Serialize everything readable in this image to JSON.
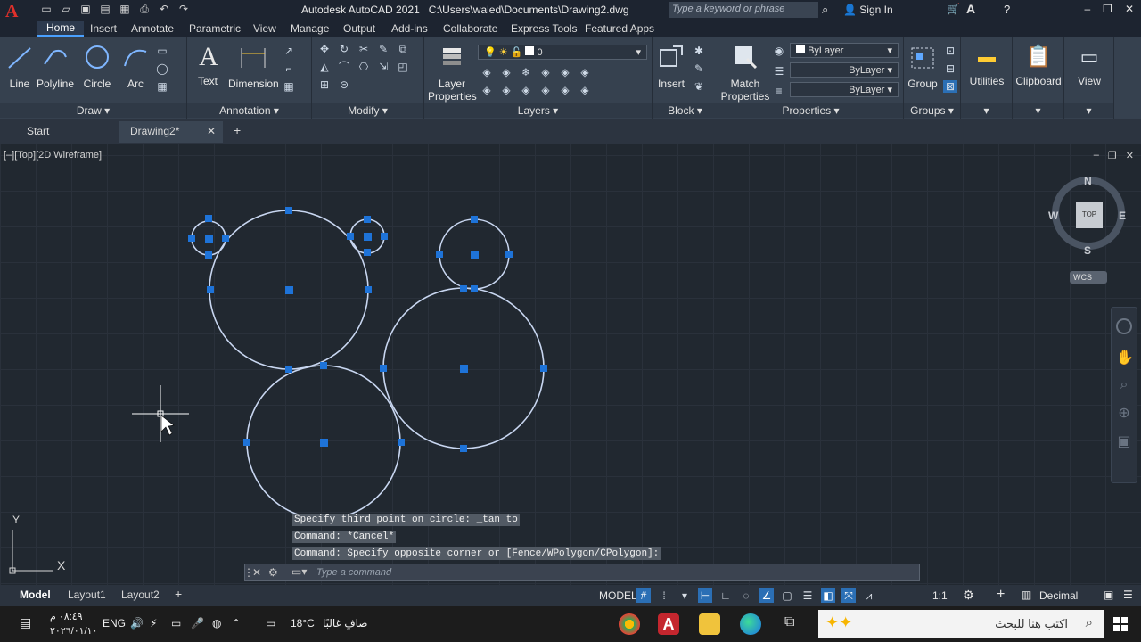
{
  "title": {
    "app": "Autodesk AutoCAD 2021",
    "path": "C:\\Users\\waled\\Documents\\Drawing2.dwg",
    "search_placeholder": "Type a keyword or phrase",
    "signin": "Sign In"
  },
  "ribbon_tabs": [
    "Home",
    "Insert",
    "Annotate",
    "Parametric",
    "View",
    "Manage",
    "Output",
    "Add-ins",
    "Collaborate",
    "Express Tools",
    "Featured Apps"
  ],
  "draw": {
    "line": "Line",
    "polyline": "Polyline",
    "circle": "Circle",
    "arc": "Arc",
    "title": "Draw"
  },
  "annotation": {
    "text": "Text",
    "dimension": "Dimension",
    "title": "Annotation"
  },
  "modify": {
    "title": "Modify"
  },
  "layers": {
    "layer_properties_1": "Layer",
    "layer_properties_2": "Properties",
    "layer_name": "0",
    "title": "Layers"
  },
  "block": {
    "insert": "Insert",
    "title": "Block"
  },
  "properties": {
    "match_1": "Match",
    "match_2": "Properties",
    "color": "ByLayer",
    "linetype": "ByLayer",
    "lineweight": "ByLayer",
    "title": "Properties"
  },
  "groups": {
    "group": "Group",
    "title": "Groups"
  },
  "utilities": {
    "label": "Utilities"
  },
  "clipboard": {
    "label": "Clipboard"
  },
  "view": {
    "label": "View"
  },
  "doc_tabs": {
    "start": "Start",
    "drawing": "Drawing2*",
    "close": "✕",
    "add": "+"
  },
  "viewport": {
    "label": "[–][Top][2D Wireframe]",
    "viewcube": {
      "n": "N",
      "s": "S",
      "e": "E",
      "w": "W",
      "top": "TOP",
      "wcs": "WCS"
    },
    "ucs": {
      "x": "X",
      "y": "Y"
    }
  },
  "command": {
    "history": [
      "Specify third point on circle: _tan to",
      "Command: *Cancel*",
      "Command: Specify opposite corner or [Fence/WPolygon/CPolygon]:"
    ],
    "placeholder": "Type a command"
  },
  "layout_tabs": [
    "Model",
    "Layout1",
    "Layout2"
  ],
  "status": {
    "model": "MODEL",
    "scale": "1:1",
    "units": "Decimal"
  },
  "taskbar": {
    "time": "٠٨:٤٩ م",
    "date": "٢٠٢٦/٠١/١٠",
    "lang": "ENG",
    "weather_temp": "18°C",
    "weather_text": "صافٍ غالبًا",
    "search": "اكتب هنا للبحث"
  },
  "colors": {
    "accent": "#2b6fb5",
    "grip": "#1e73d8",
    "circle": "#c8d6f0",
    "background": "#212830"
  }
}
